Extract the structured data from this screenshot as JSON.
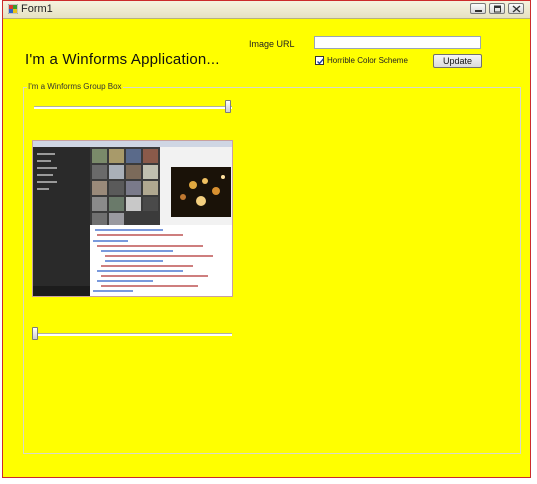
{
  "window": {
    "title": "Form1",
    "controls": {
      "minimize_icon": "minimize-icon",
      "maximize_icon": "maximize-icon",
      "close_icon": "close-icon"
    }
  },
  "form": {
    "headline": "I'm a Winforms Application...",
    "image_url_label": "Image URL",
    "image_url_value": "",
    "checkbox_label": "Horrible Color Scheme",
    "checkbox_checked": true,
    "update_button_label": "Update",
    "background_color": "#ffff00"
  },
  "group": {
    "label": "I'm a Winforms Group Box",
    "top_slider_level": 1.0,
    "bottom_slider_level": 0.0
  },
  "picture": {
    "description_icon": "screenshot-image"
  }
}
